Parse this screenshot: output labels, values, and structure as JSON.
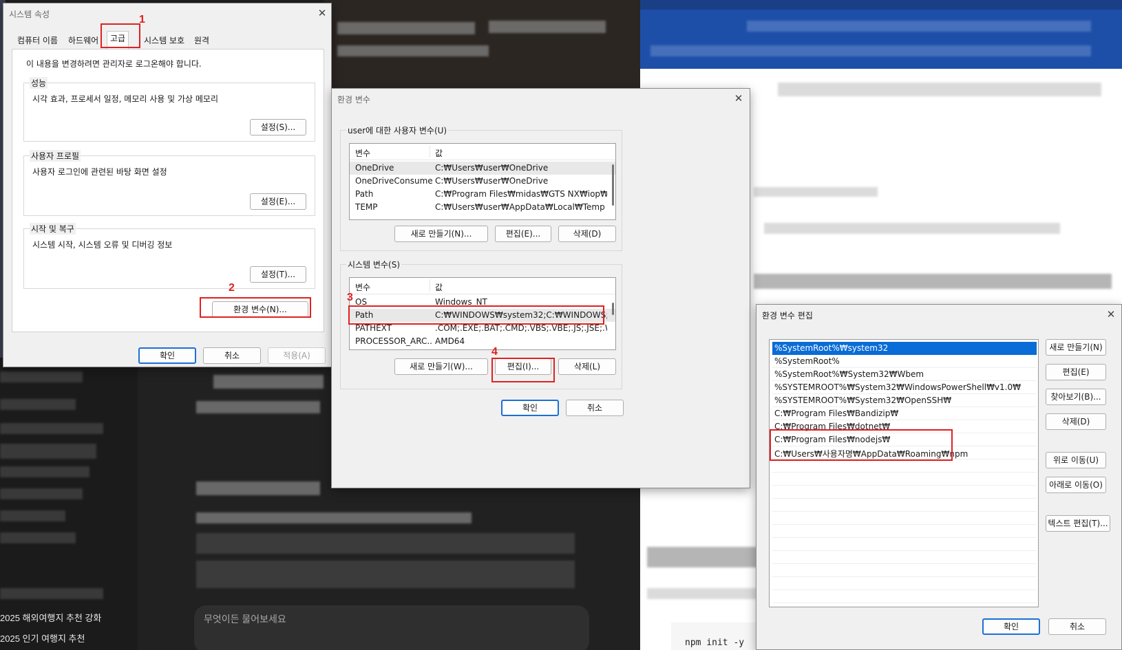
{
  "background": {
    "sidebar_items": [
      "2025 해외여행지 추천 강화",
      "2025 인기 여행지 추천"
    ],
    "ask_placeholder": "무엇이든 물어보세요",
    "code_text": "npm init -y"
  },
  "system_properties": {
    "title": "시스템 속성",
    "tabs": [
      "컴퓨터 이름",
      "하드웨어",
      "고급",
      "시스템 보호",
      "원격"
    ],
    "admin_note": "이 내용을 변경하려면 관리자로 로그온해야 합니다.",
    "performance": {
      "label": "성능",
      "desc": "시각 효과, 프로세서 일정, 메모리 사용 및 가상 메모리",
      "button": "설정(S)..."
    },
    "user_profiles": {
      "label": "사용자 프로필",
      "desc": "사용자 로그인에 관련된 바탕 화면 설정",
      "button": "설정(E)..."
    },
    "startup": {
      "label": "시작 및 복구",
      "desc": "시스템 시작, 시스템 오류 및 디버깅 정보",
      "button": "설정(T)..."
    },
    "env_button": "환경 변수(N)...",
    "ok": "확인",
    "cancel": "취소",
    "apply": "적용(A)"
  },
  "env_vars": {
    "title": "환경 변수",
    "user_group": "user에 대한 사용자 변수(U)",
    "col_var": "변수",
    "col_val": "값",
    "user_rows": [
      {
        "name": "OneDrive",
        "value": "C:₩Users₩user₩OneDrive"
      },
      {
        "name": "OneDriveConsumer",
        "value": "C:₩Users₩user₩OneDrive"
      },
      {
        "name": "Path",
        "value": "C:₩Program Files₩midas₩GTS NX₩iop₩co..."
      },
      {
        "name": "TEMP",
        "value": "C:₩Users₩user₩AppData₩Local₩Temp"
      }
    ],
    "user_buttons": {
      "new": "새로 만들기(N)...",
      "edit": "편집(E)...",
      "delete": "삭제(D)"
    },
    "system_group": "시스템 변수(S)",
    "system_rows": [
      {
        "name": "OS",
        "value": "Windows_NT"
      },
      {
        "name": "Path",
        "value": "C:₩WINDOWS₩system32;C:₩WINDOWS;C..."
      },
      {
        "name": "PATHEXT",
        "value": ".COM;.EXE;.BAT;.CMD;.VBS;.VBE;.JS;.JSE;.W..."
      },
      {
        "name": "PROCESSOR_ARC...",
        "value": "AMD64"
      }
    ],
    "system_buttons": {
      "new": "새로 만들기(W)...",
      "edit": "편집(I)...",
      "delete": "삭제(L)"
    },
    "ok": "확인",
    "cancel": "취소"
  },
  "edit_env": {
    "title": "환경 변수 편집",
    "entries": [
      "%SystemRoot%₩system32",
      "%SystemRoot%",
      "%SystemRoot%₩System32₩Wbem",
      "%SYSTEMROOT%₩System32₩WindowsPowerShell₩v1.0₩",
      "%SYSTEMROOT%₩System32₩OpenSSH₩",
      "C:₩Program Files₩Bandizip₩",
      "C:₩Program Files₩dotnet₩",
      "C:₩Program Files₩nodejs₩",
      "C:₩Users₩사용자명₩AppData₩Roaming₩npm"
    ],
    "buttons": {
      "new": "새로 만들기(N)",
      "edit": "편집(E)",
      "browse": "찾아보기(B)...",
      "delete": "삭제(D)",
      "up": "위로 이동(U)",
      "down": "아래로 이동(O)",
      "text_edit": "텍스트 편집(T)..."
    },
    "ok": "확인",
    "cancel": "취소"
  },
  "annotations": [
    "1",
    "2",
    "3",
    "4"
  ],
  "colors": {
    "highlight": "#e02020",
    "selection": "#0a6cd6",
    "browser_blue": "#1d4fa8"
  }
}
